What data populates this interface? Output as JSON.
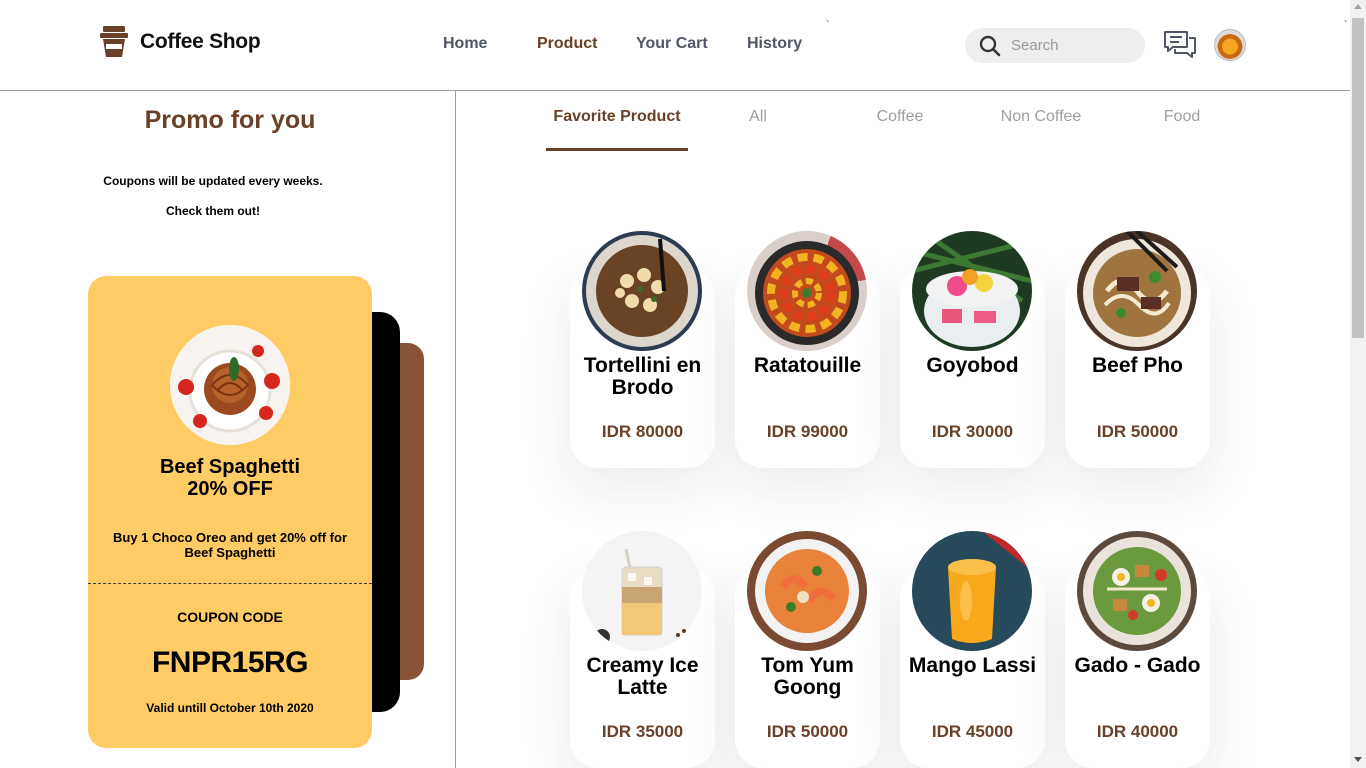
{
  "header": {
    "logo_text": "Coffee Shop",
    "nav": [
      "Home",
      "Product",
      "Your Cart",
      "History"
    ],
    "active_nav": "Product",
    "search_placeholder": "Search",
    "icons": [
      "coffee-cup-icon",
      "search-icon",
      "chat-icon",
      "avatar"
    ]
  },
  "promo": {
    "title": "Promo for you",
    "subtitle_line1": "Coupons will be updated every weeks.",
    "subtitle_line2": "Check them out!",
    "coupon": {
      "name_line1": "Beef Spaghetti",
      "name_line2": "20% OFF",
      "description": "Buy 1 Choco Oreo and get 20% off for Beef Spaghetti",
      "code_label": "COUPON CODE",
      "code": "FNPR15RG",
      "valid": "Valid untill October 10th 2020"
    }
  },
  "tabs": [
    "Favorite Product",
    "All",
    "Coffee",
    "Non Coffee",
    "Food"
  ],
  "active_tab": "Favorite Product",
  "products": [
    {
      "name": "Tortellini en Brodo",
      "price": "IDR 80000"
    },
    {
      "name": "Ratatouille",
      "price": "IDR 99000"
    },
    {
      "name": "Goyobod",
      "price": "IDR 30000"
    },
    {
      "name": "Beef Pho",
      "price": "IDR 50000"
    },
    {
      "name": "Creamy Ice Latte",
      "price": "IDR 35000"
    },
    {
      "name": "Tom Yum Goong",
      "price": "IDR 50000"
    },
    {
      "name": "Mango Lassi",
      "price": "IDR 45000"
    },
    {
      "name": "Gado - Gado",
      "price": "IDR 40000"
    }
  ],
  "colors": {
    "brown": "#6a4029",
    "coupon_yellow": "#ffcb65",
    "card_brown": "#895537",
    "nav_gray": "#4f5665",
    "tab_gray": "#9f9f9f"
  }
}
